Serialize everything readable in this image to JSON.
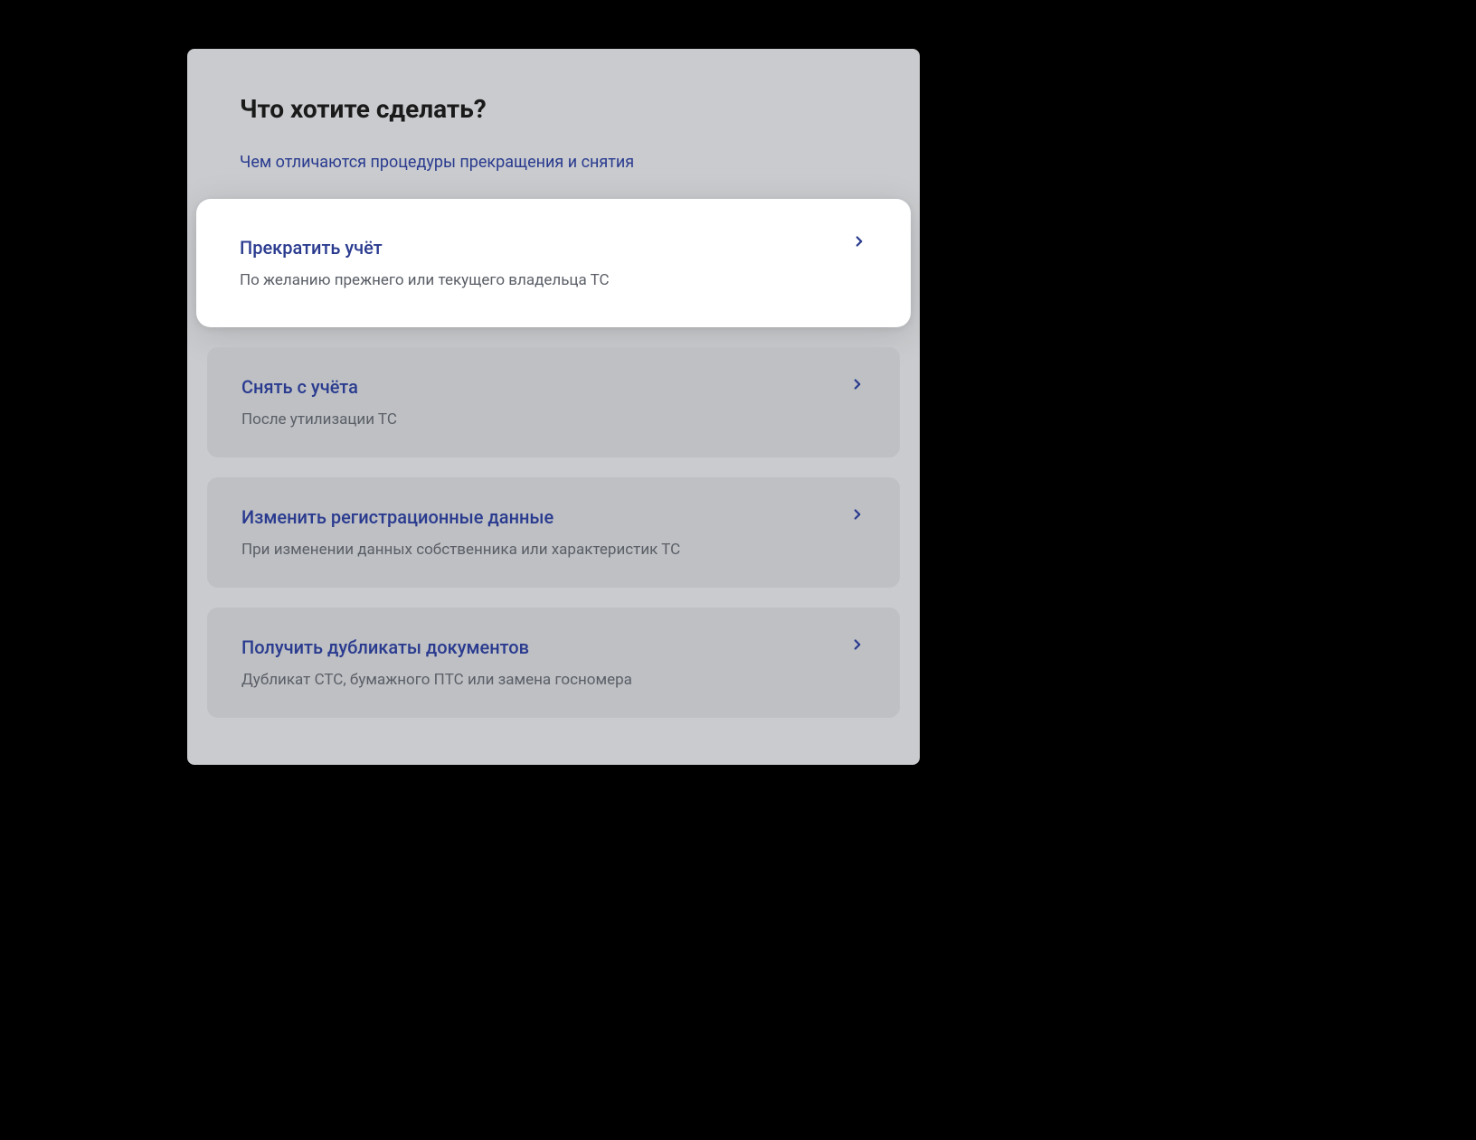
{
  "page_title": "Что хотите сделать?",
  "hint_link": "Чем отличаются процедуры прекращения и снятия",
  "options": [
    {
      "title": "Прекратить учёт",
      "subtitle": "По желанию прежнего или текущего владельца ТС",
      "highlighted": true
    },
    {
      "title": "Снять с учёта",
      "subtitle": "После утилизации ТС",
      "highlighted": false
    },
    {
      "title": "Изменить регистрационные данные",
      "subtitle": "При изменении данных собственника или характеристик ТС",
      "highlighted": false
    },
    {
      "title": "Получить дубликаты документов",
      "subtitle": "Дубликат СТС, бумажного ПТС или замена госномера",
      "highlighted": false
    }
  ]
}
